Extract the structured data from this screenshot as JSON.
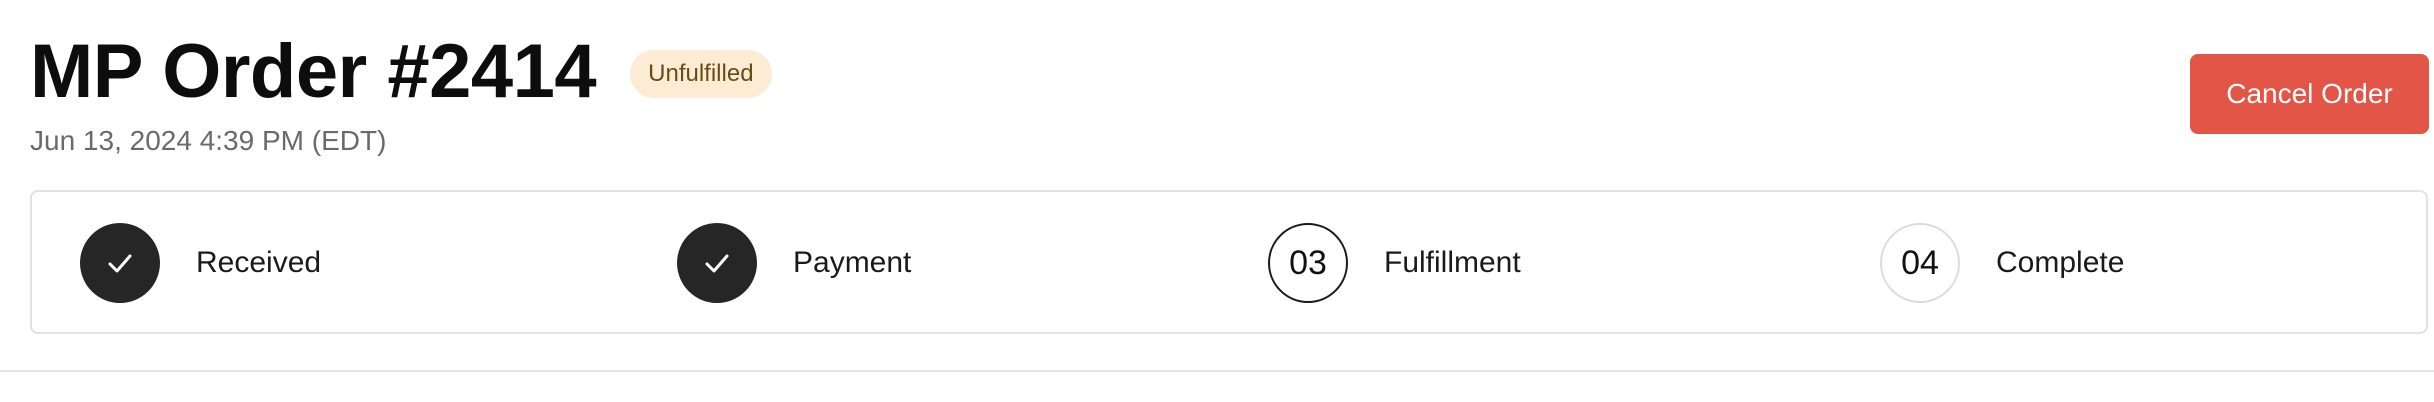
{
  "header": {
    "title": "MP Order #2414",
    "status": "Unfulfilled",
    "date": "Jun 13, 2024 4:39 PM (EDT)"
  },
  "actions": {
    "cancel_label": "Cancel Order"
  },
  "progress": {
    "steps": [
      {
        "label": "Received",
        "state": "done",
        "icon": "check-icon"
      },
      {
        "label": "Payment",
        "state": "done",
        "icon": "check-icon"
      },
      {
        "label": "Fulfillment",
        "state": "current",
        "number": "03"
      },
      {
        "label": "Complete",
        "state": "upcoming",
        "number": "04"
      }
    ]
  },
  "colors": {
    "badge_bg": "#fcecd3",
    "badge_text": "#6b4b16",
    "cancel_button": "#e25547",
    "step_done": "#262626"
  }
}
